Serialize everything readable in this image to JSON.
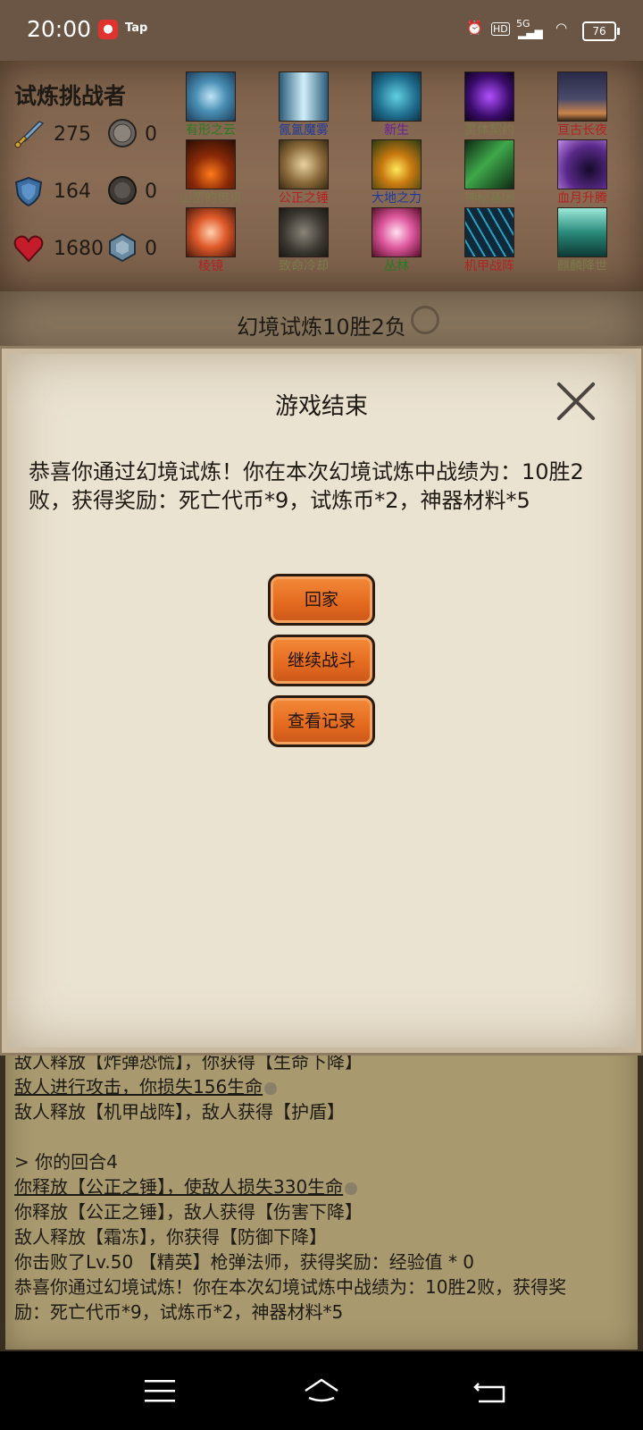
{
  "status_bar": {
    "time": "20:00",
    "app_badge": "Tap",
    "network": "5G",
    "hd": "HD",
    "battery": "76"
  },
  "player": {
    "title": "试炼挑战者",
    "attack": "275",
    "defense": "164",
    "health": "1680",
    "coin_a": "0",
    "coin_b": "0",
    "coin_c": "0"
  },
  "skills": [
    {
      "label": "有形之云",
      "color": "#2a7a1f"
    },
    {
      "label": "氤氲魔雾",
      "color": "#1f3a9c"
    },
    {
      "label": "新生",
      "color": "#6a1f9c"
    },
    {
      "label": "灵体契约",
      "color": "#7a7a4a"
    },
    {
      "label": "亘古长夜",
      "color": "#b22222"
    },
    {
      "label": "山峦的忠贞",
      "color": "#7a7a4a"
    },
    {
      "label": "公正之锤",
      "color": "#b22222"
    },
    {
      "label": "大地之力",
      "color": "#1f3a9c"
    },
    {
      "label": "神秘基因",
      "color": "#7a7a4a"
    },
    {
      "label": "血月升腾",
      "color": "#b22222"
    },
    {
      "label": "棱镜",
      "color": "#b22222"
    },
    {
      "label": "致命冷却",
      "color": "#7a7a4a"
    },
    {
      "label": "丛林",
      "color": "#2a7a1f"
    },
    {
      "label": "机甲战阵",
      "color": "#b22222"
    },
    {
      "label": "麒麟降世",
      "color": "#7a7a4a"
    }
  ],
  "battle_title": "幻境试炼10胜2负",
  "dialog": {
    "title": "游戏结束",
    "message": "恭喜你通过幻境试炼！你在本次幻境试炼中战绩为：10胜2败，获得奖励：死亡代币*9，试炼币*2，神器材料*5",
    "buttons": {
      "home": "回家",
      "continue": "继续战斗",
      "records": "查看记录"
    }
  },
  "log": [
    {
      "text": "敌人释放【炸弹恐慌】，你获得【生命下降】",
      "underline": false
    },
    {
      "text": "敌人进行攻击，你损失156生命",
      "underline": true
    },
    {
      "text": "敌人释放【机甲战阵】，敌人获得【护盾】",
      "underline": false
    },
    {
      "text": "",
      "underline": false
    },
    {
      "text": "> 你的回合4",
      "underline": false
    },
    {
      "text": "你释放【公正之锤】，使敌人损失330生命",
      "underline": true
    },
    {
      "text": "你释放【公正之锤】，敌人获得【伤害下降】",
      "underline": false
    },
    {
      "text": "敌人释放【霜冻】，你获得【防御下降】",
      "underline": false
    },
    {
      "text": "你击败了Lv.50 【精英】枪弹法师，获得奖励：经验值 * 0",
      "underline": false
    },
    {
      "text": "恭喜你通过幻境试炼！你在本次幻境试炼中战绩为：10胜2败，获得奖",
      "underline": false
    },
    {
      "text": "励：死亡代币*9，试炼币*2，神器材料*5",
      "underline": false
    }
  ]
}
